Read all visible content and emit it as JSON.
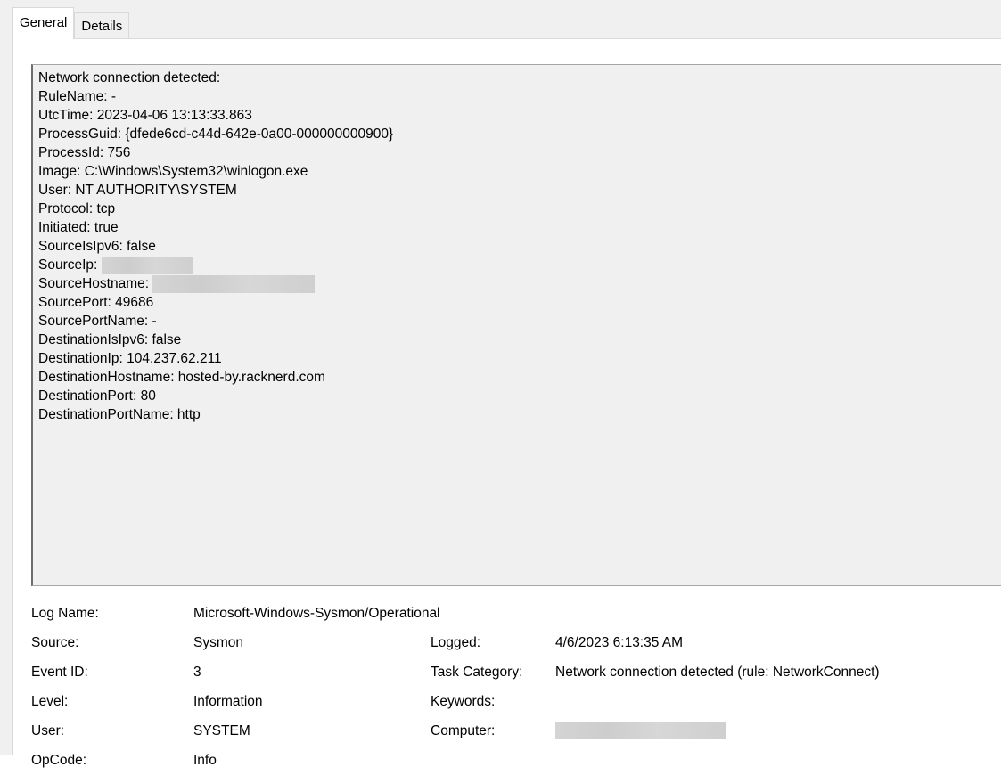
{
  "tabs": [
    {
      "label": "General",
      "active": true
    },
    {
      "label": "Details",
      "active": false
    }
  ],
  "description": {
    "lines": [
      "Network connection detected:",
      "RuleName: -",
      "UtcTime: 2023-04-06 13:13:33.863",
      "ProcessGuid: {dfede6cd-c44d-642e-0a00-000000000900}",
      "ProcessId: 756",
      "Image: C:\\Windows\\System32\\winlogon.exe",
      "User: NT AUTHORITY\\SYSTEM",
      "Protocol: tcp",
      "Initiated: true",
      "SourceIsIpv6: false",
      "SourceIp: ",
      "SourceHostname: ",
      "SourcePort: 49686",
      "SourcePortName: -",
      "DestinationIsIpv6: false",
      "DestinationIp: 104.237.62.211",
      "DestinationHostname: hosted-by.racknerd.com",
      "DestinationPort: 80",
      "DestinationPortName: http"
    ]
  },
  "meta": {
    "log_name_label": "Log Name:",
    "log_name_value": "Microsoft-Windows-Sysmon/Operational",
    "source_label": "Source:",
    "source_value": "Sysmon",
    "logged_label": "Logged:",
    "logged_value": "4/6/2023 6:13:35 AM",
    "event_id_label": "Event ID:",
    "event_id_value": "3",
    "task_category_label": "Task Category:",
    "task_category_value": "Network connection detected (rule: NetworkConnect)",
    "level_label": "Level:",
    "level_value": "Information",
    "keywords_label": "Keywords:",
    "keywords_value": "",
    "user_label": "User:",
    "user_value": "SYSTEM",
    "computer_label": "Computer:",
    "opcode_label": "OpCode:",
    "opcode_value": "Info"
  }
}
